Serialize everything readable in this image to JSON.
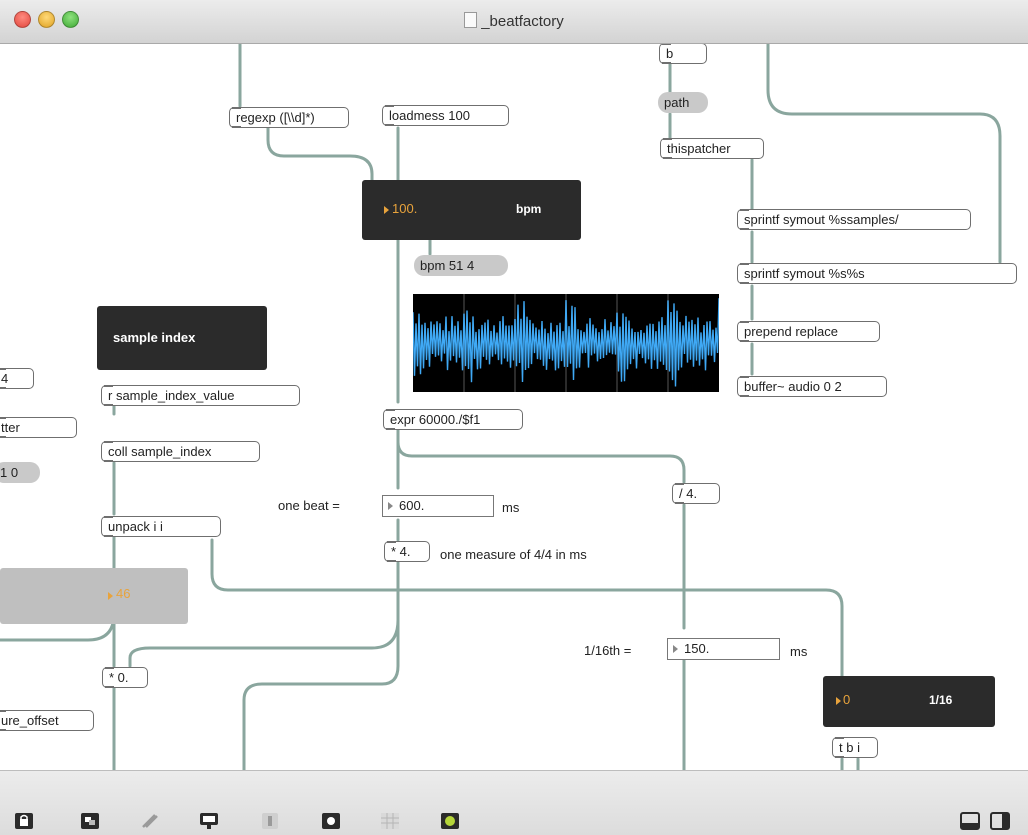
{
  "window": {
    "title": "_beatfactory"
  },
  "patcher": {
    "objects": {
      "regexp": "regexp ([\\\\d]*)",
      "loadmess": "loadmess 100",
      "thispatcher": "thispatcher",
      "sprintf_samples": "sprintf symout %ssamples/",
      "sprintf_symout": "sprintf symout %s%s",
      "prepend": "prepend replace",
      "buffer": "buffer~ audio 0 2",
      "receive": "r sample_index_value",
      "coll": "coll sample_index",
      "expr": "expr 60000./$f1",
      "unpack": "unpack i i",
      "div4": "/ 4.",
      "mul4": "* 4.",
      "mul0": "* 0.",
      "tbi": "t b i",
      "left_partial_1": "4",
      "left_partial_2": "tter",
      "left_partial_3": "ure_offset",
      "top_partial": "b"
    },
    "messages": {
      "path": "path",
      "bpm_msg": "bpm 51 4",
      "left_msg": "1 0"
    },
    "panels": {
      "bpm": {
        "value": "100.",
        "unit": "bpm"
      },
      "sample_index": {
        "title": "sample index"
      },
      "left_number": {
        "value": "46"
      },
      "division": {
        "value": "0",
        "unit": "1/16"
      }
    },
    "numbers": {
      "beat_ms": "600.",
      "sixteenth_ms": "150."
    },
    "labels": {
      "one_beat": "one beat =",
      "ms1": "ms",
      "measure": "one measure of 4/4 in ms",
      "sixteenth": "1/16th =",
      "ms2": "ms"
    },
    "colors": {
      "cord": "#8aa69e",
      "panel_dark": "#2b2b2b",
      "number_accent": "#e8a33c",
      "waveform": "#3fa9f5"
    }
  },
  "toolbar": {
    "icons": [
      "lock-icon",
      "presentation-icon",
      "paint-icon",
      "debug-icon",
      "inspector-icon",
      "clue-icon",
      "grid-icon",
      "snapshot-icon"
    ],
    "right_icons": [
      "left-sidebar-icon",
      "right-sidebar-icon"
    ]
  }
}
